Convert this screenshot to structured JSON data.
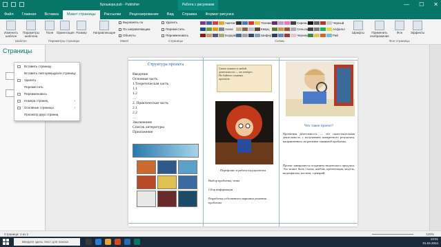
{
  "titlebar": {
    "title": "Брошюра.pub - Publisher",
    "context_tab": "Работа с рисунками",
    "min": "—",
    "max": "☐",
    "close": "✕"
  },
  "tabs": [
    "Файл",
    "Главная",
    "Вставка",
    "Макет страницы",
    "Рассылки",
    "Рецензирование",
    "Вид",
    "Справка",
    "Формат рисунка"
  ],
  "ribbon": {
    "buttons": {
      "templates": "Изменить шаблон",
      "options": "Параметры шаблона",
      "fields": "Поля",
      "orientation": "Ориентация",
      "size": "Размер",
      "guides": "Направляющие",
      "fonts": "Шрифты",
      "effects": "Эффекты",
      "bg": "Фон",
      "apply": "Применить изображение"
    },
    "checks": [
      "Выровнять по",
      "По направляющим",
      "Объекты",
      "Удалить",
      "Переместить",
      "Переименовать"
    ],
    "groups": {
      "template": "Шаблон",
      "page": "Параметры страницы",
      "layout": "Макет",
      "pages": "Страницы",
      "schemes": "Схемы",
      "bg": "Фон страницы"
    },
    "schemes": [
      "Аметист",
      "Апекс",
      "Бордовый",
      "Техника",
      "Черный",
      "Кварц",
      "Шифер",
      "Сирень",
      "Сельский",
      "Черника",
      "Асфальт",
      "Рай"
    ]
  },
  "pages_pane": {
    "title": "Страницы"
  },
  "context_menu": {
    "items": [
      {
        "label": "Вставить страницу",
        "arrow": ""
      },
      {
        "label": "Вставить повторяющуюся страницу",
        "arrow": ""
      },
      {
        "label": "Удалить",
        "arrow": ""
      },
      {
        "label": "Переместить",
        "arrow": ""
      },
      {
        "label": "Переименовать",
        "arrow": ""
      },
      {
        "label": "Номера страниц",
        "arrow": "›"
      },
      {
        "label": "Основные страницы",
        "arrow": "›"
      },
      {
        "label": "Просмотр двух страниц",
        "arrow": ""
      }
    ]
  },
  "doc": {
    "col1": {
      "title": "Структура проекта",
      "toc": [
        "Введение",
        "Основная часть",
        "1.Теоретическая часть",
        "1.1",
        "1.2",
        "…",
        "2. Практическая часть",
        "2.1",
        "2.2",
        "…",
        "Заключение",
        "Список литературы",
        "Приложение"
      ]
    },
    "col2": {
      "caption": "Самое главное в любой деятельности — это интерес. Не бойтесь сложных проектов.",
      "label1": "Портфолио и работа над проектом",
      "label2": "Выбор проблемы, темы",
      "label3": "Сбор информации",
      "label4": "Разработка собственного варианта решения проблемы"
    },
    "col3": {
      "heading": "Что такое проект?",
      "p1": "Проектная деятельность — это самостоятельная деятельность с получением конкретного результата, направленного на решение значимой проблемы.",
      "p2": "Проект завершается созданием творческого продукта. Это может быть статья, альбом, презентация, модель, видеофильм, костюм, сценарий."
    }
  },
  "status": {
    "page": "Страница: 1 из 2",
    "zoom": "120%"
  },
  "taskbar": {
    "search": "Введите здесь текст для поиска",
    "time": "13:01",
    "date": "01.04.2024"
  }
}
